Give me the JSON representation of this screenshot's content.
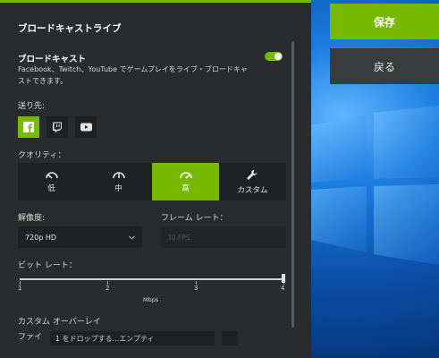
{
  "panel": {
    "title": "ブロードキャストライブ",
    "broadcast_label": "ブロードキャスト",
    "broadcast_desc_line1": "Facebook、Twitch、YouTube でゲームプレイをライブ・ブロードキャ",
    "broadcast_desc_line2": "ストできます。",
    "broadcast_enabled": true,
    "destination_label": "送り先:",
    "destinations": [
      {
        "name": "facebook",
        "active": true
      },
      {
        "name": "twitch",
        "active": false
      },
      {
        "name": "youtube",
        "active": false
      }
    ],
    "quality_label": "クオリティ：",
    "quality_options": [
      {
        "label": "低",
        "icon": "gauge-low-icon"
      },
      {
        "label": "中",
        "icon": "gauge-medium-icon"
      },
      {
        "label": "高",
        "icon": "gauge-high-icon"
      },
      {
        "label": "カスタム",
        "icon": "wrench-icon"
      }
    ],
    "quality_selected": "高",
    "resolution_label": "解像度:",
    "resolution_value": "720p HD",
    "framerate_label": "フレーム レート：",
    "framerate_value": "30 FPS",
    "bitrate_label": "ビット レート：",
    "bitrate_ticks": [
      "1",
      "2",
      "3",
      "4"
    ],
    "bitrate_unit": "Mbps",
    "bitrate_value": 4,
    "overlay_label": "カスタム オーバーレイ",
    "overlay_file_label": "ファイ",
    "overlay_file_value": "1 をドロップする...エンプティ"
  },
  "actions": {
    "save_label": "保存",
    "back_label": "戻る"
  },
  "colors": {
    "accent": "#76b900",
    "panel_bg": "#2a2b2c",
    "control_bg": "#1f2021"
  }
}
